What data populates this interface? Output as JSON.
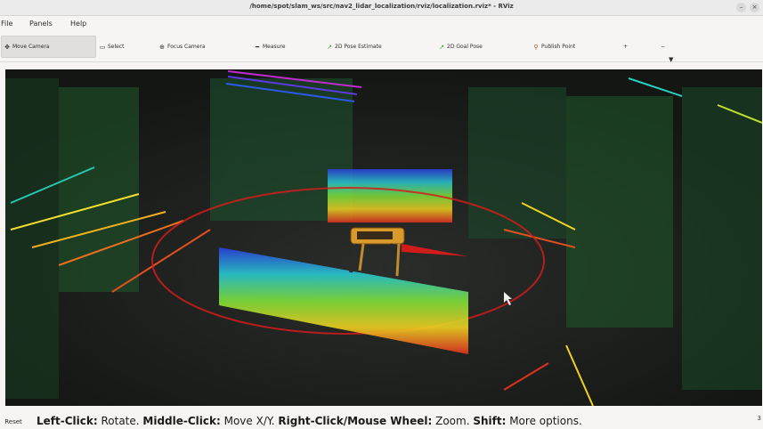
{
  "window": {
    "title": "/home/spot/slam_ws/src/nav2_lidar_localization/rviz/localization.rviz* - RViz",
    "minimize_symbol": "–",
    "close_symbol": "×"
  },
  "menubar": {
    "items": [
      "File",
      "Panels",
      "Help"
    ]
  },
  "toolbar": {
    "tools": [
      {
        "label": "Move Camera",
        "icon": "move-camera-icon",
        "active": true
      },
      {
        "label": "Select",
        "icon": "select-icon"
      },
      {
        "label": "Focus Camera",
        "icon": "focus-camera-icon"
      },
      {
        "label": "Measure",
        "icon": "measure-icon"
      },
      {
        "label": "2D Pose Estimate",
        "icon": "pose-arrow-icon"
      },
      {
        "label": "2D Goal Pose",
        "icon": "goal-arrow-icon"
      },
      {
        "label": "Publish Point",
        "icon": "pin-icon"
      }
    ],
    "add_tool_symbol": "+",
    "remove_tool_symbol": "−",
    "dropdown_symbol": "▼"
  },
  "viewport": {
    "description_icons": [
      "robot",
      "point-cloud",
      "pose-arrow"
    ]
  },
  "statusbar": {
    "reset_label": "Reset",
    "hint_parts": [
      {
        "text": "Left-Click:",
        "bold": true
      },
      {
        "text": " Rotate. ",
        "bold": false
      },
      {
        "text": "Middle-Click:",
        "bold": true
      },
      {
        "text": " Move X/Y. ",
        "bold": false
      },
      {
        "text": "Right-Click/Mouse Wheel:",
        "bold": true
      },
      {
        "text": " Zoom. ",
        "bold": false
      },
      {
        "text": "Shift:",
        "bold": true
      },
      {
        "text": " More options.",
        "bold": false
      }
    ],
    "corner_text": "3"
  },
  "colors": {
    "viewport_bg": "#1c1f1c",
    "accent_green": "#2f9e2f",
    "arrow_red": "#d21c1c"
  }
}
